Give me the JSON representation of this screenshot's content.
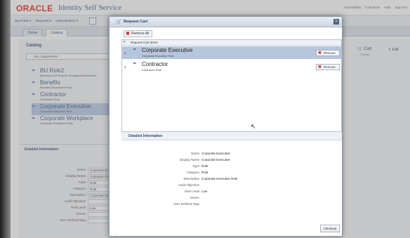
{
  "header": {
    "logo": "ORACLE",
    "app_title": "Identity Self Service",
    "global_links": [
      "Accessibility",
      "Customize",
      "Help",
      "Sign Out"
    ]
  },
  "nav": {
    "menus": [
      "My Profile ▾",
      "Requests ▾",
      "Administration ▾"
    ]
  },
  "tabs": [
    {
      "label": "Home"
    },
    {
      "label": "Catalog"
    }
  ],
  "catalog": {
    "title": "Catalog",
    "search_value": "role | department",
    "items": [
      {
        "title": "BU Role2",
        "subtitle": "Business Unit Role for Delegated Administrat"
      },
      {
        "title": "Benefits",
        "subtitle": "Benefits Department Role"
      },
      {
        "title": "Contractor",
        "subtitle": "Contractor Role"
      },
      {
        "title": "Corporate Executive",
        "subtitle": "Corporate Executive Role"
      },
      {
        "title": "Corporate Workplace",
        "subtitle": "Corporate Workplace Role"
      }
    ],
    "detail_header": "Detailed Information",
    "detail_rows": [
      {
        "k": "Name",
        "v": "Corporate Exec"
      },
      {
        "k": "Display Name",
        "v": "Corporate Exec"
      },
      {
        "k": "Type",
        "v": "Role"
      },
      {
        "k": "Category",
        "v": "Role"
      },
      {
        "k": "Description",
        "v": "Corporate Exec"
      },
      {
        "k": "Audit Objective",
        "v": ""
      },
      {
        "k": "Risk Level",
        "v": "Low"
      },
      {
        "k": "Owner",
        "v": ""
      },
      {
        "k": "User Defined Tags",
        "v": ""
      }
    ]
  },
  "cart": {
    "label": "Cart",
    "count": "2 Items",
    "edit_label": "Edit"
  },
  "modal": {
    "title": "Request Cart",
    "remove_all": "Remove All",
    "col_index": "#",
    "col_items": "Request Cart Items",
    "remove_label": "Remove",
    "items": [
      {
        "num": "1",
        "title": "Corporate Executive",
        "subtitle": "Corporate Executive Role"
      },
      {
        "num": "2",
        "title": "Contractor",
        "subtitle": "Contractor Role"
      }
    ],
    "detail_header": "Detailed Information",
    "detail_rows": [
      {
        "k": "Name",
        "v": "Corporate Executive"
      },
      {
        "k": "Display Name",
        "v": "Corporate Executive"
      },
      {
        "k": "Type",
        "v": "Role"
      },
      {
        "k": "Category",
        "v": "Role"
      },
      {
        "k": "Description",
        "v": "Corporate Executive Role"
      },
      {
        "k": "Audit Objective",
        "v": ""
      },
      {
        "k": "Risk Level",
        "v": "Low"
      },
      {
        "k": "Owner",
        "v": ""
      },
      {
        "k": "User Defined Tags",
        "v": ""
      }
    ],
    "checkout": "Checkout"
  }
}
